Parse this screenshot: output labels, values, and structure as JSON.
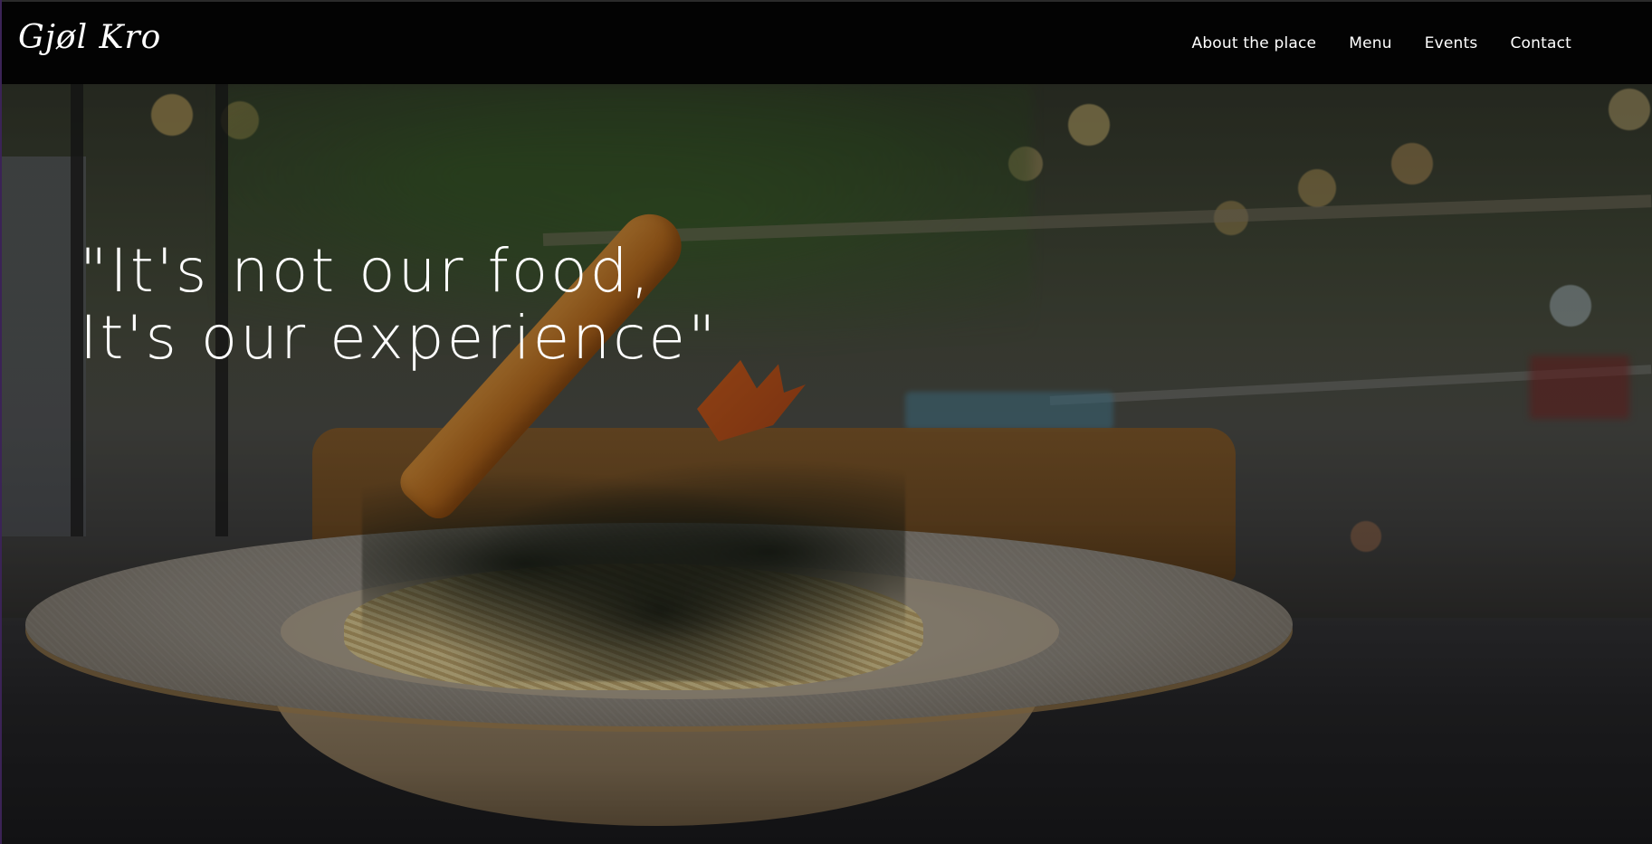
{
  "brand": {
    "logo_text": "Gjøl Kro"
  },
  "nav": {
    "items": [
      {
        "label": "About the place"
      },
      {
        "label": "Menu"
      },
      {
        "label": "Events"
      },
      {
        "label": "Contact"
      }
    ]
  },
  "hero": {
    "tagline_line1": "\"It's not our food,",
    "tagline_line2": "It's our experience\"",
    "image": "photo of fried shrimp on spaghetti with seaweed in a white plate on a restaurant table"
  },
  "colors": {
    "header_bg": "#030303",
    "text": "#ffffff"
  }
}
